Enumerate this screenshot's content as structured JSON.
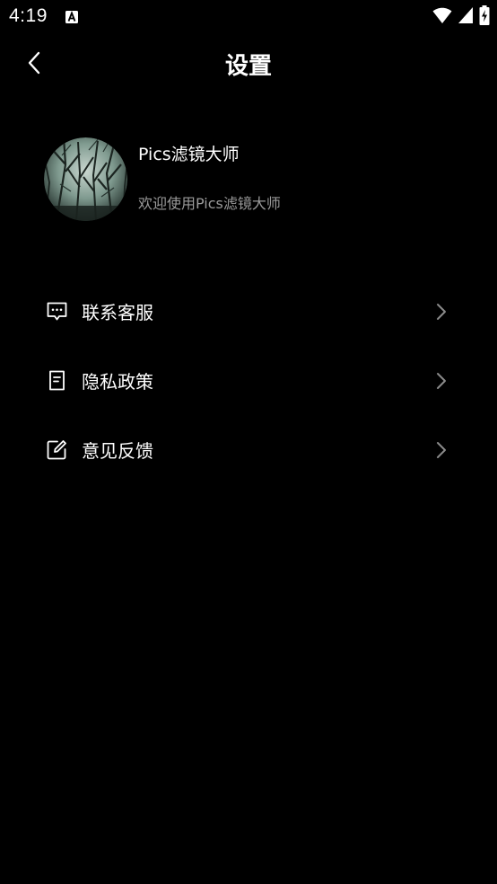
{
  "status_bar": {
    "time": "4:19",
    "notification_icon": "a-square-icon",
    "wifi_icon": "wifi-icon",
    "signal_icon": "signal-icon",
    "battery_icon": "battery-charging-icon"
  },
  "header": {
    "back_icon": "chevron-left-icon",
    "title": "设置"
  },
  "profile": {
    "avatar_icon": "forest-avatar-image",
    "name": "Pics滤镜大师",
    "subtitle": "欢迎使用Pics滤镜大师"
  },
  "menu": {
    "items": [
      {
        "icon": "message-dots-icon",
        "label": "联系客服"
      },
      {
        "icon": "document-icon",
        "label": "隐私政策"
      },
      {
        "icon": "edit-icon",
        "label": "意见反馈"
      }
    ],
    "chevron_icon": "chevron-right-icon"
  },
  "colors": {
    "background": "#000000",
    "primary_text": "#ffffff",
    "secondary_text": "#9a9a9a",
    "chevron": "#8a8a8a"
  }
}
